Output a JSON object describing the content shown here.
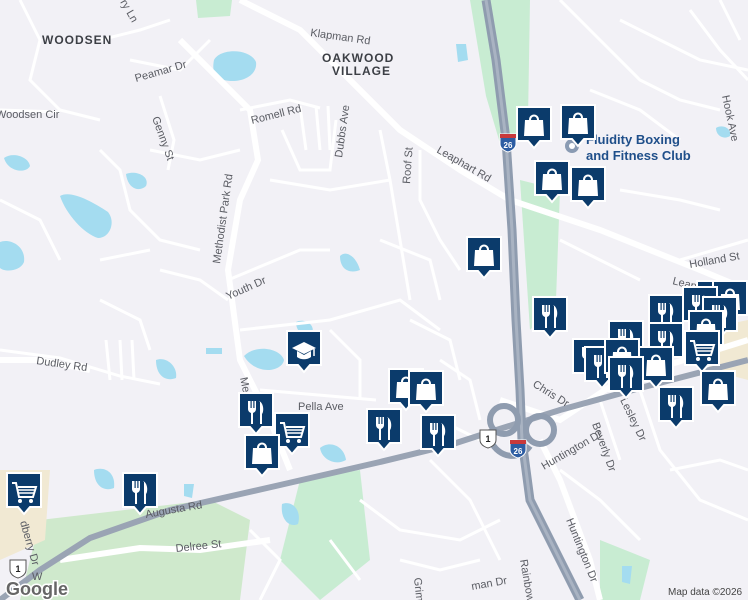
{
  "map": {
    "areas": [
      "WOODSEN",
      "OAKWOOD",
      "VILLAGE"
    ],
    "roads": {
      "klapman": "Klapman Rd",
      "peamar": "Peamar Dr",
      "woodsen_cir": "Woodsen Cir",
      "romell": "Romell Rd",
      "dubbs": "Dubbs Ave",
      "genny": "Genny St",
      "methodist_park": "Methodist Park Rd",
      "methodist_lower": "Me",
      "roof": "Roof St",
      "leaphart": "Leaphart Rd",
      "leaphart_east": "Leaph",
      "youth": "Youth Dr",
      "dudley": "Dudley Rd",
      "pella": "Pella Ave",
      "augusta": "Augusta Rd",
      "delree": "Delree St",
      "holland": "Holland St",
      "hook": "Hook Ave",
      "chris": "Chris Dr",
      "lesley": "Lesley Dr",
      "beverly": "Beverly Dr",
      "huntington": "Huntington Dr",
      "huntington2": "Huntington Dr",
      "rainbow": "Rainbow",
      "grim": "Grim",
      "man": "man Dr",
      "edberry": "dberry Dr",
      "w": "W",
      "ry_ln": "ry Ln"
    },
    "shields": {
      "i26_a": "26",
      "i26_b": "26",
      "us1_a": "1",
      "us1_b": "1"
    },
    "poi": {
      "fitness_line1": "Fluidity Boxing",
      "fitness_line2": "and Fitness Club"
    },
    "attribution": "Map data ©2026",
    "logo": "Google",
    "colors": {
      "water": "#a4dcf0",
      "park": "#c8ecd2",
      "interstate": "#8f9caf",
      "marker": "#0b3b6b"
    }
  },
  "markers": [
    {
      "type": "shopping-bag",
      "name": "m1"
    },
    {
      "type": "shopping-bag",
      "name": "m2"
    },
    {
      "type": "shopping-bag",
      "name": "m3"
    },
    {
      "type": "shopping-bag",
      "name": "m4"
    },
    {
      "type": "shopping-bag",
      "name": "m5"
    },
    {
      "type": "restaurant",
      "name": "m6"
    },
    {
      "type": "school",
      "name": "m7"
    },
    {
      "type": "shopping-bag",
      "name": "m8"
    },
    {
      "type": "restaurant",
      "name": "m9"
    },
    {
      "type": "restaurant",
      "name": "m10"
    },
    {
      "type": "restaurant",
      "name": "m11"
    },
    {
      "type": "shopping-cart",
      "name": "m12"
    },
    {
      "type": "shopping-bag",
      "name": "m13"
    },
    {
      "type": "shopping-cart",
      "name": "m14"
    },
    {
      "type": "restaurant",
      "name": "m15"
    }
  ]
}
